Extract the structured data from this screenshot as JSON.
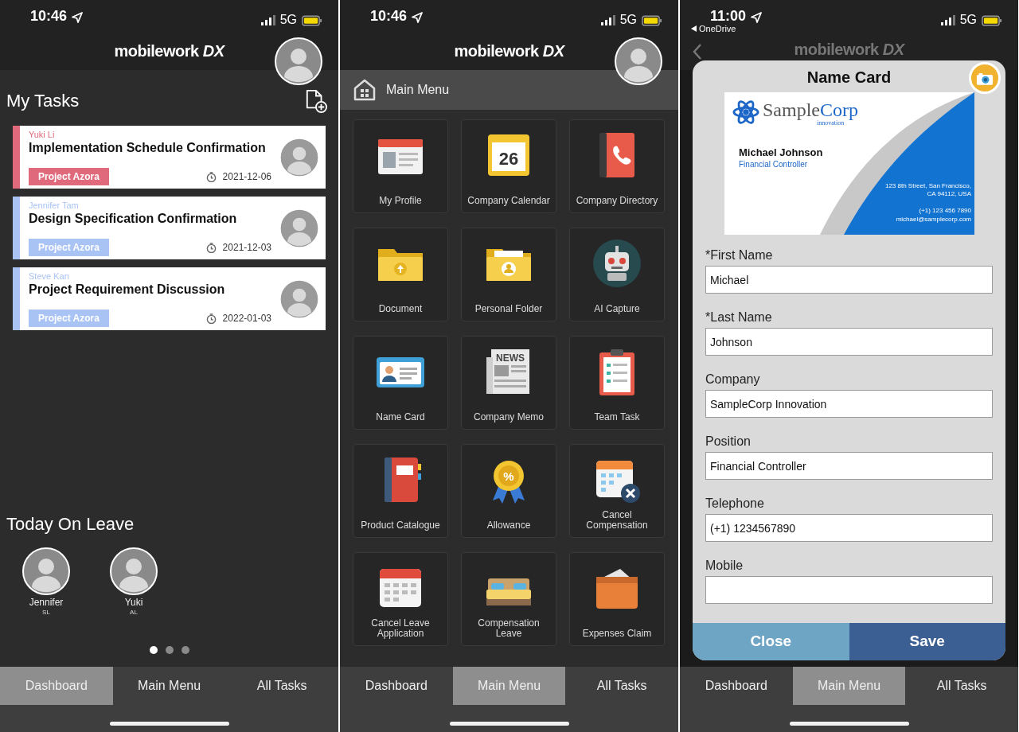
{
  "screens": [
    {
      "kind": "dashboard",
      "status_bar": {
        "time": "10:46",
        "network": "5G"
      },
      "logo": "mobilework *DX*",
      "tasks_title": "My Tasks",
      "tasks": [
        {
          "assignee": "Yuki Li",
          "title": "Implementation Schedule Confirmation",
          "project": "Project Azora",
          "date": "2021-12-06",
          "color": "#e06a7c"
        },
        {
          "assignee": "Jennifer Tam",
          "title": "Design Specification Confirmation",
          "project": "Project Azora",
          "date": "2021-12-03",
          "color": "#a9c3f5"
        },
        {
          "assignee": "Steve Kan",
          "title": "Project Requirement Discussion",
          "project": "Project Azora",
          "date": "2022-01-03",
          "color": "#a9c3f5"
        }
      ],
      "leave_title": "Today On Leave",
      "on_leave": [
        {
          "name": "Jennifer",
          "type": "SL"
        },
        {
          "name": "Yuki",
          "type": "AL"
        }
      ],
      "pages": [
        {
          "selected": true
        },
        {
          "selected": false
        },
        {
          "selected": false
        }
      ],
      "tabs": [
        {
          "label": "Dashboard",
          "selected": true
        },
        {
          "label": "Main Menu",
          "selected": false
        },
        {
          "label": "All Tasks",
          "selected": false
        }
      ]
    },
    {
      "kind": "main_menu",
      "status_bar": {
        "time": "10:46",
        "network": "5G"
      },
      "logo": "mobilework *DX*",
      "menu_title": "Main Menu",
      "tiles": [
        {
          "label": "My Profile"
        },
        {
          "label": "Company Calendar",
          "icon_text": "26"
        },
        {
          "label": "Company Directory"
        },
        {
          "label": "Document"
        },
        {
          "label": "Personal Folder"
        },
        {
          "label": "AI Capture"
        },
        {
          "label": "Name Card"
        },
        {
          "label": "Company Memo",
          "icon_text": "NEWS"
        },
        {
          "label": "Team Task"
        },
        {
          "label": "Product Catalogue"
        },
        {
          "label": "Allowance",
          "icon_text": "%"
        },
        {
          "label": "Cancel Compensation"
        },
        {
          "label": "Cancel Leave Application"
        },
        {
          "label": "Compensation Leave"
        },
        {
          "label": "Expenses Claim"
        }
      ],
      "tabs": [
        {
          "label": "Dashboard",
          "selected": false
        },
        {
          "label": "Main Menu",
          "selected": true
        },
        {
          "label": "All Tasks",
          "selected": false
        }
      ]
    },
    {
      "kind": "name_card",
      "status_bar": {
        "time": "11:00",
        "network": "5G",
        "back_app": "OneDrive"
      },
      "logo": "mobilework *DX*",
      "dialog": {
        "title": "Name Card",
        "card": {
          "company": [
            "Sample",
            "Corp"
          ],
          "company_sub": "innovation",
          "name": "Michael Johnson",
          "position": "Financial Controller",
          "address": [
            "123 8th Street, San Francisco,",
            "CA 94112, USA"
          ],
          "phone": "(+1) 123 456 7890",
          "email": "michael@samplecorp.com"
        },
        "fields": [
          {
            "label": "*First Name",
            "value": "Michael"
          },
          {
            "label": "*Last Name",
            "value": "Johnson"
          },
          {
            "label": "Company",
            "value": "SampleCorp Innovation"
          },
          {
            "label": "Position",
            "value": "Financial Controller"
          },
          {
            "label": "Telephone",
            "value": "(+1) 1234567890"
          },
          {
            "label": "Mobile"
          }
        ],
        "buttons": [
          {
            "label": "Close",
            "kind": "secondary"
          },
          {
            "label": "Save",
            "kind": "primary"
          }
        ]
      },
      "tabs": [
        {
          "label": "Dashboard",
          "selected": false
        },
        {
          "label": "Main Menu",
          "selected": true
        },
        {
          "label": "All Tasks",
          "selected": false
        }
      ]
    }
  ]
}
